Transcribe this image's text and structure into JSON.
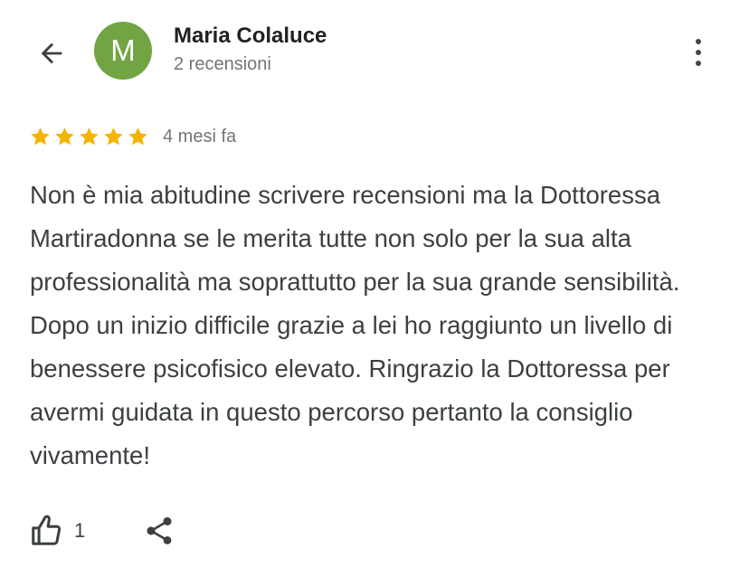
{
  "header": {
    "back_icon": "arrow-left-icon",
    "more_icon": "more-vertical-icon"
  },
  "reviewer": {
    "initial": "M",
    "avatar_color": "#72a444",
    "name": "Maria Colaluce",
    "reviews_count": "2 recensioni"
  },
  "review": {
    "rating": 5,
    "max_rating": 5,
    "star_color": "#f4b400",
    "time": "4 mesi fa",
    "text": "Non è mia abitudine scrivere recensioni ma la Dottoressa Martiradonna se le merita tutte non solo per la sua alta professionalità ma soprattutto per la sua grande sensibilità. Dopo un inizio difficile grazie a lei ho raggiunto un livello di benessere psicofisico elevato. Ringrazio la Dottoressa per avermi guidata in questo percorso pertanto la consiglio vivamente!"
  },
  "actions": {
    "like_icon": "thumb-up-icon",
    "like_count": "1",
    "share_icon": "share-icon"
  }
}
